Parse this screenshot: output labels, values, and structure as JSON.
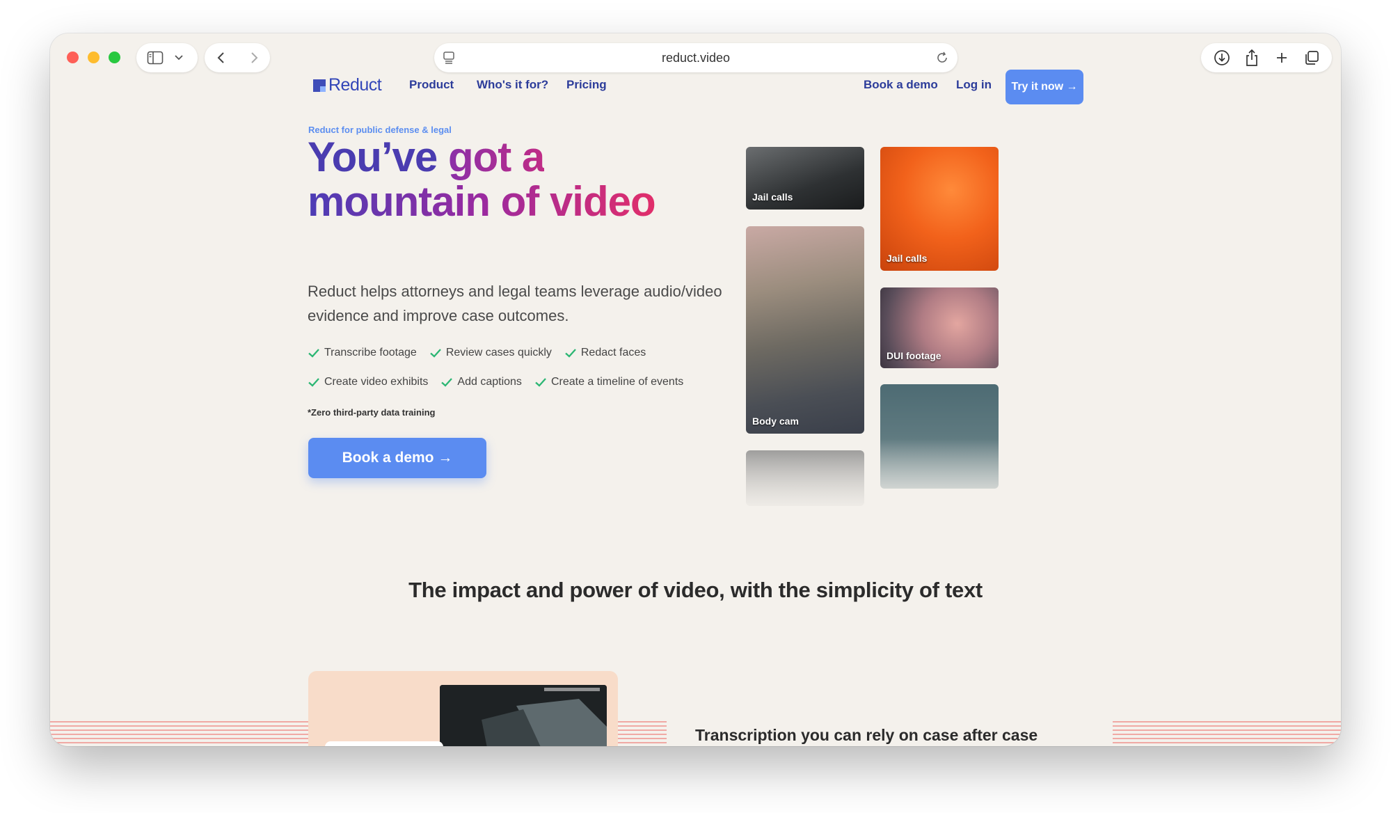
{
  "browser": {
    "url": "reduct.video"
  },
  "site": {
    "brand": "Reduct",
    "nav": {
      "product": "Product",
      "whos_it_for": "Who's it for?",
      "pricing": "Pricing",
      "book_demo": "Book a demo",
      "login": "Log in",
      "try_now": "Try it now →"
    }
  },
  "hero": {
    "eyebrow": "Reduct for public defense & legal",
    "headline_line1_a": "You’ve ",
    "headline_line1_b": "got a",
    "headline_line2": "mountain of video",
    "subtitle": "Reduct helps attorneys and legal teams leverage audio/video evidence and improve case outcomes.",
    "features_row1": [
      "Transcribe footage",
      "Review cases quickly",
      "Redact faces"
    ],
    "features_row2": [
      "Create video exhibits",
      "Add captions",
      "Create a timeline of events"
    ],
    "footnote": "*Zero third-party data training",
    "cta": "Book a demo →"
  },
  "tiles": [
    {
      "label": "Jail calls"
    },
    {
      "label": "Jail calls"
    },
    {
      "label": "Body cam"
    },
    {
      "label": "DUI footage"
    },
    {
      "label": ""
    },
    {
      "label": ""
    }
  ],
  "section": {
    "title": "The impact and power of video, with the simplicity of text",
    "feature_heading": "Transcription you can rely on case after case"
  },
  "colors": {
    "accent": "#5b8cf1",
    "nav_text": "#2c3c9a",
    "check": "#2bb673",
    "stripes": "#f0a9a4"
  }
}
